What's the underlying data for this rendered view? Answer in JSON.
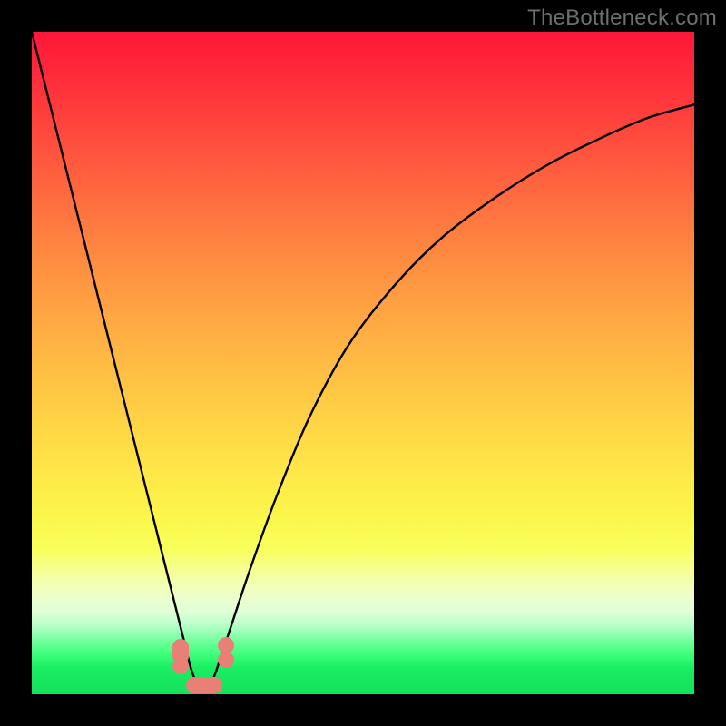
{
  "watermark": "TheBottleneck.com",
  "chart_data": {
    "type": "line",
    "title": "",
    "xlabel": "",
    "ylabel": "",
    "xlim": [
      0,
      100
    ],
    "ylim": [
      0,
      100
    ],
    "grid": false,
    "series": [
      {
        "name": "bottleneck-curve",
        "x": [
          0,
          3,
          6,
          9,
          12,
          15,
          17.5,
          19.5,
          21.5,
          23,
          24,
          25,
          26,
          27,
          28,
          30,
          33,
          37,
          42,
          48,
          55,
          62,
          70,
          78,
          86,
          93,
          100
        ],
        "y": [
          100,
          88,
          76,
          64,
          52,
          40,
          30,
          22,
          14,
          8,
          4,
          1.5,
          0.8,
          1.5,
          4,
          10,
          19,
          30,
          42,
          53,
          62,
          69,
          75,
          80,
          84,
          87,
          89
        ]
      }
    ],
    "markers": [
      {
        "name": "left-bump-top",
        "x": 22.5,
        "y": 6.5,
        "shape": "vert"
      },
      {
        "name": "left-bump-bot",
        "x": 22.5,
        "y": 4.2,
        "shape": "round"
      },
      {
        "name": "right-bump-top",
        "x": 29.3,
        "y": 7.4,
        "shape": "round"
      },
      {
        "name": "right-bump-bot",
        "x": 29.3,
        "y": 5.2,
        "shape": "round"
      },
      {
        "name": "bottom-bump",
        "x": 26.0,
        "y": 1.4,
        "shape": "horiz"
      }
    ],
    "background_gradient": {
      "top": "#ff1739",
      "mid": "#ffe647",
      "bottom": "#14e25c"
    }
  }
}
